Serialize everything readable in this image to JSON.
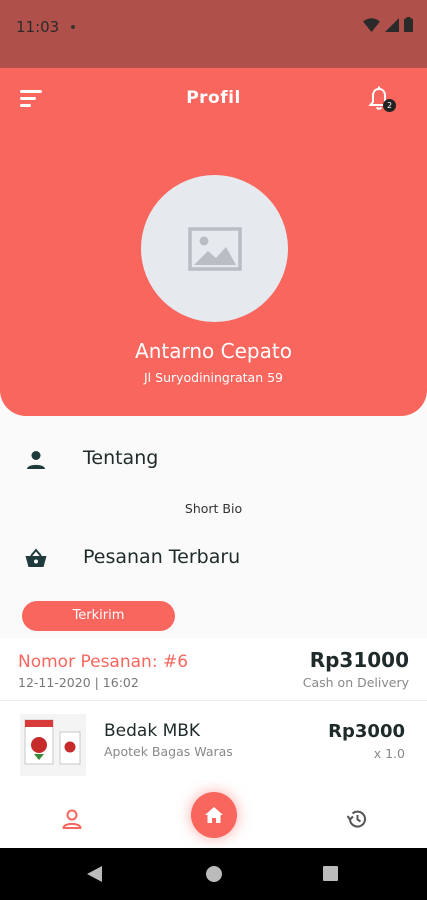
{
  "status_bar": {
    "time": "11:03"
  },
  "header": {
    "title": "Profil",
    "notification_count": "2",
    "user_name": "Antarno Cepato",
    "user_address": "Jl Suryodiningratan 59"
  },
  "about": {
    "title": "Tentang",
    "bio": "Short Bio"
  },
  "orders": {
    "title": "Pesanan Terbaru",
    "status_tab": "Terkirim",
    "order_number": "Nomor Pesanan: #6",
    "order_date": "12-11-2020 | 16:02",
    "total": "Rp31000",
    "payment_method": "Cash on Delivery",
    "item": {
      "name": "Bedak MBK",
      "store": "Apotek Bagas Waras",
      "price": "Rp3000",
      "quantity": "x 1.0"
    }
  },
  "colors": {
    "accent": "#f8665e",
    "status_bar": "#b0504a",
    "dark_text": "#1f2a2a"
  }
}
